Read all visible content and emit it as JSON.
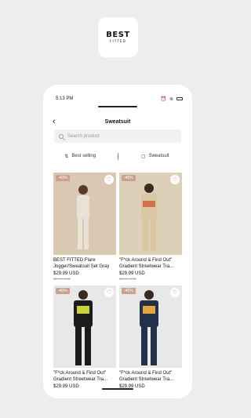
{
  "logo": {
    "main": "BEST",
    "sub": "FITTED"
  },
  "status": {
    "time": "5:13 PM"
  },
  "nav": {
    "back": "‹",
    "title": "Sweatsuit"
  },
  "search": {
    "placeholder": "Search product"
  },
  "filters": {
    "sort_label": "Best selling",
    "category_label": "Sweatsuit"
  },
  "products": [
    {
      "badge": "-40%",
      "name_line1": "BEST FITTED Flare",
      "name_line2": "Jogger/Sweatsuit Set Gray",
      "price": "$29.99 USD",
      "old_price": "$49.99 USD",
      "photo_color": "#d9c9b3",
      "figure_color": "#e9e2d6"
    },
    {
      "badge": "-40%",
      "name_line1": "\"F*ck Around & Find Out\"",
      "name_line2": "Gradient Streetwear Tra...",
      "price": "$29.99 USD",
      "old_price": "$49.99 USD",
      "photo_color": "#ddd0b8",
      "figure_color": "#d9c7a4"
    },
    {
      "badge": "-40%",
      "name_line1": "\"F*ck Around & Find Out\"",
      "name_line2": "Gradient Streetwear Tra...",
      "price": "$29.99 USD",
      "old_price": "",
      "photo_color": "#e8e8e8",
      "figure_color": "#1b1b1b"
    },
    {
      "badge": "-40%",
      "name_line1": "\"F*ck Around & Find Out\"",
      "name_line2": "Gradient Streetwear Tra...",
      "price": "$29.99 USD",
      "old_price": "",
      "photo_color": "#e8e8e8",
      "figure_color": "#22304a"
    }
  ]
}
